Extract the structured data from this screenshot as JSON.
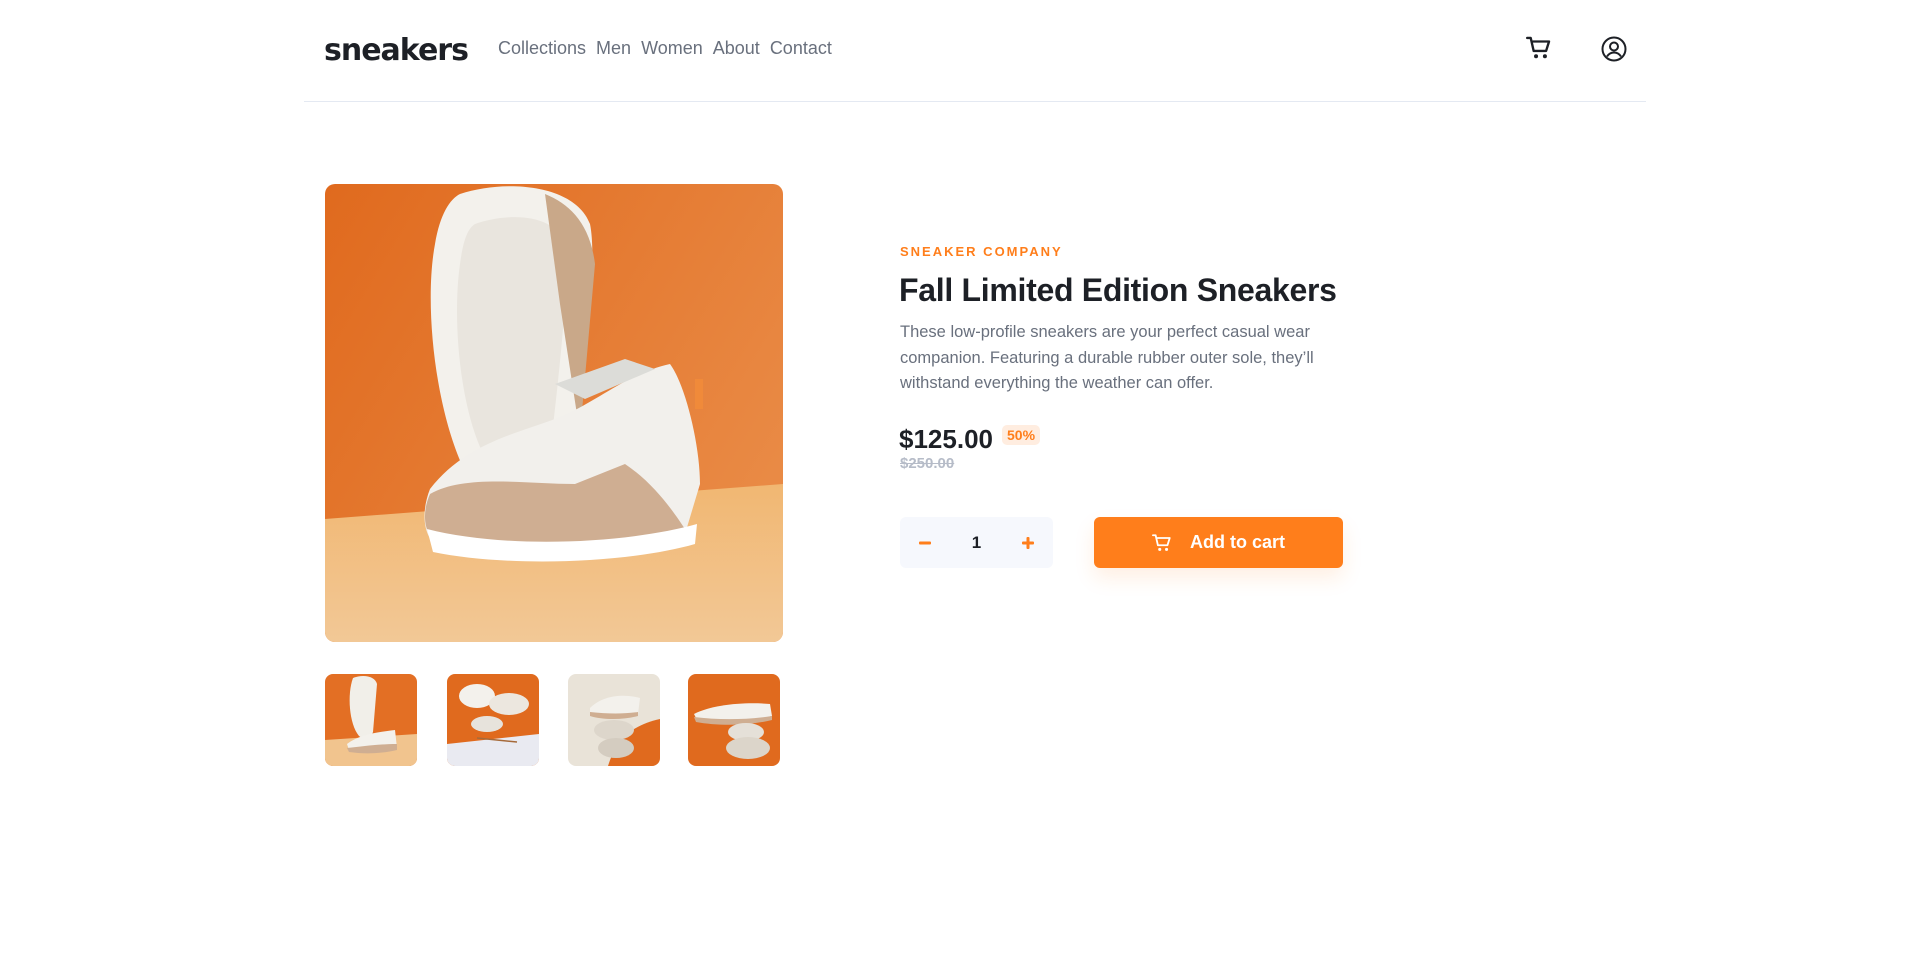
{
  "brand": {
    "logo_text": "sneakers",
    "accent_color": "#ff7e1b"
  },
  "nav": {
    "items": [
      {
        "label": "Collections"
      },
      {
        "label": "Men"
      },
      {
        "label": "Women"
      },
      {
        "label": "About"
      },
      {
        "label": "Contact"
      }
    ]
  },
  "header": {
    "cart_icon": "cart-icon",
    "avatar_icon": "user-circle-icon"
  },
  "gallery": {
    "main_image_alt": "sneaker product photo",
    "thumbnails": [
      {
        "icon": "thumbnail-1"
      },
      {
        "icon": "thumbnail-2"
      },
      {
        "icon": "thumbnail-3"
      },
      {
        "icon": "thumbnail-4"
      }
    ]
  },
  "product": {
    "company": "SNEAKER COMPANY",
    "title": "Fall Limited Edition Sneakers",
    "description": "These low-profile sneakers are your perfect casual wear companion. Featuring a durable rubber outer sole, they’ll withstand everything the weather can offer.",
    "price": "$125.00",
    "discount": "50%",
    "original_price": "$250.00"
  },
  "quantity": {
    "minus_icon": "minus-icon",
    "plus_icon": "plus-icon",
    "value": "1"
  },
  "add_to_cart": {
    "label": "Add to cart",
    "icon": "cart-icon"
  }
}
